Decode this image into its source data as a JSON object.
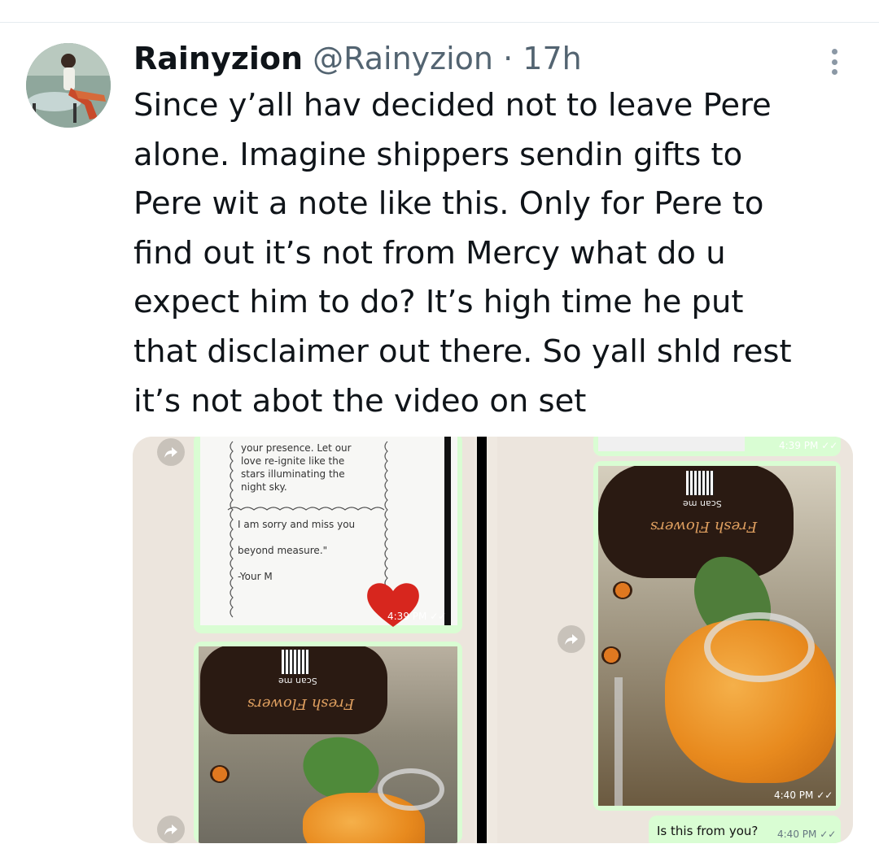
{
  "tweet": {
    "author_name": "Rainyzion",
    "author_handle": "@Rainyzion",
    "separator": "·",
    "time": "17h",
    "text": "Since y’all hav decided not to leave Pere\nalone. Imagine shippers sendin gifts to\nPere wit a note like this. Only for Pere to\nfind out it’s not from Mercy what do u\nexpect him to do? It’s high time he put\nthat disclaimer out there. So yall shld rest\nit’s not abot the video on set",
    "more_icon": "more-vertical-icon"
  },
  "media": {
    "left": {
      "note_top": "your presence. Let our\nlove re-ignite like the\nstars illuminating the\nnight sky.",
      "note_bottom": "I am sorry and miss you\n\nbeyond measure.\"\n\n-Your M",
      "time_1": "4:39 PM",
      "brand": "Fresh Flowers",
      "scan": "Scan me"
    },
    "right": {
      "time_top": "4:39 PM",
      "brand": "Fresh Flowers",
      "scan": "Scan me",
      "time_photo": "4:40 PM",
      "question": "Is this from you?",
      "question_time": "4:40 PM"
    },
    "colors": {
      "bubble": "#d9fdd3",
      "chat_bg": "#ece5dd",
      "ticks": "#53bdeb"
    }
  }
}
